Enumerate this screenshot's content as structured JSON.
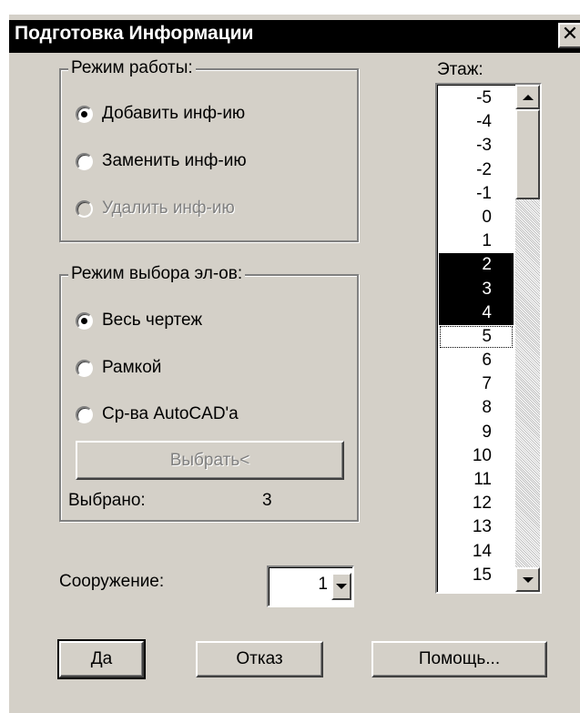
{
  "window": {
    "title": "Подготовка  Информации",
    "close_glyph": "✕"
  },
  "work_mode": {
    "label": "Режим работы:",
    "options": [
      {
        "label": "Добавить инф-ию",
        "checked": true,
        "enabled": true
      },
      {
        "label": "Заменить инф-ию",
        "checked": false,
        "enabled": true
      },
      {
        "label": "Удалить  инф-ию",
        "checked": false,
        "enabled": false
      }
    ]
  },
  "selection_mode": {
    "label": "Режим выбора эл-ов:",
    "options": [
      {
        "label": "Весь чертеж",
        "checked": true
      },
      {
        "label": "Рамкой",
        "checked": false
      },
      {
        "label": "Ср-ва AutoCAD'а",
        "checked": false
      }
    ],
    "select_button": "Выбрать<",
    "selected_label": "Выбрано:",
    "selected_count": "3"
  },
  "floor": {
    "label": "Этаж:",
    "items": [
      "-5",
      "-4",
      "-3",
      "-2",
      "-1",
      "0",
      "1",
      "2",
      "3",
      "4",
      "5",
      "6",
      "7",
      "8",
      "9",
      "10",
      "11",
      "12",
      "13",
      "14",
      "15"
    ],
    "selected": [
      "2",
      "3",
      "4"
    ],
    "focused": "5"
  },
  "structure": {
    "label": "Сооружение:",
    "value": "1"
  },
  "buttons": {
    "ok": "Да",
    "cancel": "Отказ",
    "help": "Помощь..."
  },
  "icons": {
    "scroll_up": "triangle-up-icon",
    "scroll_down": "triangle-down-icon",
    "combo_dropdown": "triangle-down-icon"
  }
}
